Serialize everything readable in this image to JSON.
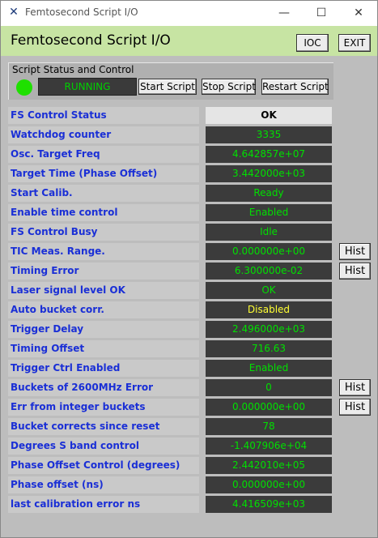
{
  "window": {
    "title": "Femtosecond Script I/O"
  },
  "header": {
    "title": "Femtosecond Script I/O",
    "ioc_label": "IOC",
    "exit_label": "EXIT"
  },
  "status": {
    "panel_title": "Script Status and Control",
    "state": "RUNNING",
    "led_color": "#1fe000",
    "start_label": "Start Script",
    "stop_label": "Stop Script",
    "restart_label": "Restart Script"
  },
  "hist_label": "Hist",
  "rows": [
    {
      "label": "FS Control Status",
      "value": "OK"
    },
    {
      "label": "Watchdog counter",
      "value": "3335"
    },
    {
      "label": "Osc. Target Freq",
      "value": "4.642857e+07"
    },
    {
      "label": "Target Time (Phase Offset)",
      "value": "3.442000e+03"
    },
    {
      "label": "Start Calib.",
      "value": "Ready"
    },
    {
      "label": "Enable time control",
      "value": "Enabled"
    },
    {
      "label": "FS Control Busy",
      "value": "Idle"
    },
    {
      "label": "TIC Meas. Range.",
      "value": "0.000000e+00"
    },
    {
      "label": "Timing Error",
      "value": "6.300000e-02"
    },
    {
      "label": "Laser signal level OK",
      "value": "OK"
    },
    {
      "label": "Auto bucket corr.",
      "value": "Disabled"
    },
    {
      "label": "Trigger Delay",
      "value": "2.496000e+03"
    },
    {
      "label": "Timing Offset",
      "value": "716.63"
    },
    {
      "label": "Trigger Ctrl Enabled",
      "value": "Enabled"
    },
    {
      "label": "Buckets of 2600MHz Error",
      "value": "0"
    },
    {
      "label": "Err from integer buckets",
      "value": "0.000000e+00"
    },
    {
      "label": "Bucket corrects since reset",
      "value": "78"
    },
    {
      "label": "Degrees S band control",
      "value": "-1.407906e+04"
    },
    {
      "label": "Phase Offset Control (degrees)",
      "value": "2.442010e+05"
    },
    {
      "label": "Phase offset (ns)",
      "value": "0.000000e+00"
    },
    {
      "label": "last calibration error ns",
      "value": "4.416509e+03"
    }
  ]
}
